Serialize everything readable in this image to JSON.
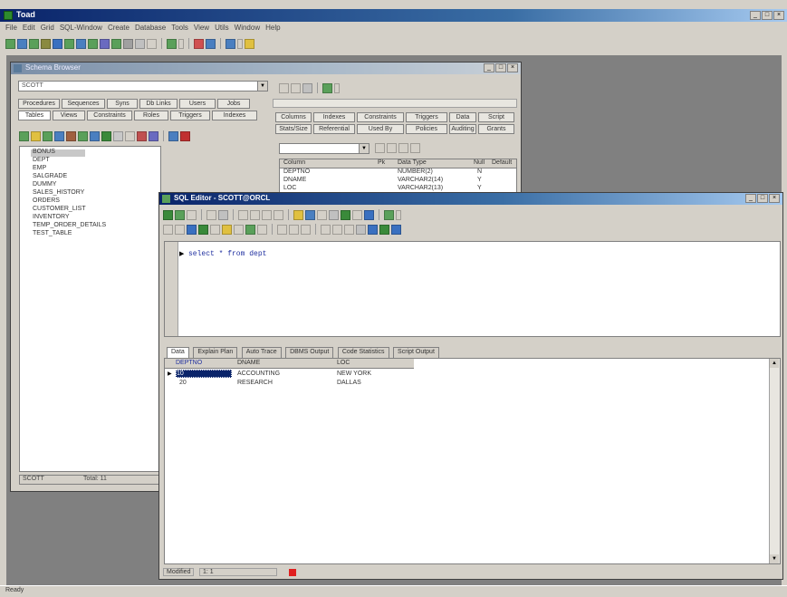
{
  "app": {
    "title": "Toad",
    "menu": [
      "File",
      "Edit",
      "Grid",
      "SQL-Window",
      "Create",
      "Database",
      "Tools",
      "View",
      "Utils",
      "Window",
      "Help"
    ]
  },
  "browser": {
    "title": "Schema Browser",
    "schema_value": "SCOTT",
    "tabs_row1": [
      "Procedures",
      "Sequences",
      "Syns",
      "Db Links",
      "Users",
      "Jobs"
    ],
    "tabs_row2": [
      "Tables",
      "Views",
      "Constraints",
      "Roles",
      "Triggers",
      "Indexes"
    ],
    "tree_items": [
      "BONUS",
      "DEPT",
      "EMP",
      "SALGRADE",
      "DUMMY",
      "SALES_HISTORY",
      "ORDERS",
      "CUSTOMER_LIST",
      "INVENTORY",
      "TEMP_ORDER_DETAILS",
      "TEST_TABLE"
    ],
    "detail_tabs_row1": [
      "Columns",
      "Indexes",
      "Constraints",
      "Triggers",
      "Data",
      "Script"
    ],
    "detail_tabs_row2": [
      "Stats/Size",
      "Referential",
      "Used By",
      "Policies",
      "Auditing",
      "Grants"
    ],
    "columns_header": [
      "Column",
      "Pk",
      "Data Type",
      "Null",
      "Default"
    ],
    "columns_rows": [
      [
        "DEPTNO",
        "",
        "NUMBER(2)",
        "N",
        ""
      ],
      [
        "DNAME",
        "",
        "VARCHAR2(14)",
        "Y",
        ""
      ],
      [
        "LOC",
        "",
        "VARCHAR2(13)",
        "Y",
        ""
      ]
    ],
    "status_left": "SCOTT",
    "status_right": "Total: 11"
  },
  "editor": {
    "title": "SQL Editor - SCOTT@ORCL",
    "sql_text": "select * from dept",
    "result_tabs": [
      "Data",
      "Explain Plan",
      "Auto Trace",
      "DBMS Output",
      "Code Statistics",
      "Script Output"
    ],
    "grid_headers": [
      "DEPTNO",
      "DNAME",
      "LOC"
    ],
    "grid_rows": [
      [
        "10",
        "ACCOUNTING",
        "NEW YORK"
      ],
      [
        "20",
        "RESEARCH",
        "DALLAS"
      ]
    ],
    "status_left": "Modified",
    "status_mid": "1: 1"
  },
  "status_bar": "Ready",
  "colors": {
    "desktop": "#808080",
    "title_active": "#0a246a",
    "chrome": "#d4d0c8",
    "selection": "#0a246a"
  }
}
